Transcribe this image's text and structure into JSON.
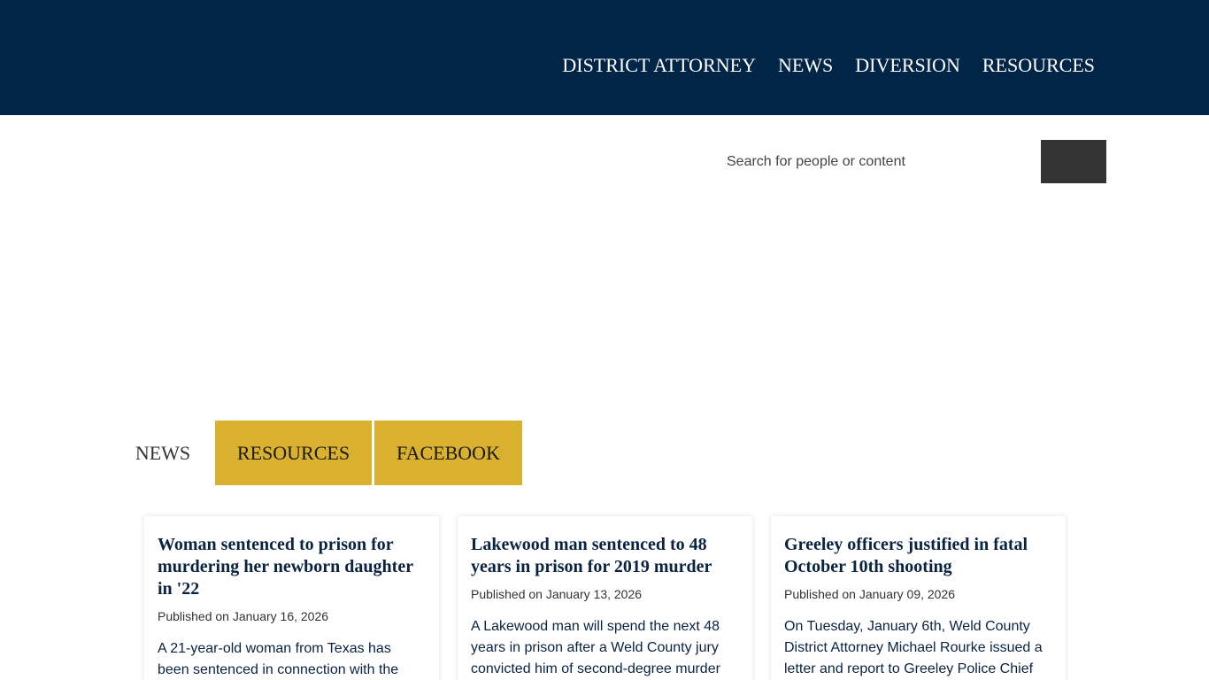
{
  "nav": {
    "items": [
      {
        "label": "DISTRICT ATTORNEY"
      },
      {
        "label": "NEWS"
      },
      {
        "label": "DIVERSION"
      },
      {
        "label": "RESOURCES"
      }
    ]
  },
  "search": {
    "placeholder": "Search for people or content"
  },
  "tabs": [
    {
      "label": "NEWS"
    },
    {
      "label": "RESOURCES"
    },
    {
      "label": "FACEBOOK"
    }
  ],
  "colors": {
    "header_bg": "#002546",
    "tab_accent": "#d9b12e",
    "search_button": "#333333"
  },
  "news": [
    {
      "title": "Woman sentenced to prison for murdering her newborn daughter in '22",
      "date": "Published on January 16, 2026",
      "excerpt": "A 21-year-old woman from Texas has been sentenced in connection with the"
    },
    {
      "title": "Lakewood man sentenced to 48 years in prison for 2019 murder",
      "date": "Published on January 13, 2026",
      "excerpt": "A Lakewood man will spend the next 48 years in prison after a Weld County jury convicted him of second-degree murder"
    },
    {
      "title": "Greeley officers justified in fatal October 10th shooting",
      "date": "Published on January 09, 2026",
      "excerpt": "On Tuesday, January 6th, Weld County District Attorney Michael Rourke issued a letter and report to Greeley Police Chief"
    }
  ]
}
